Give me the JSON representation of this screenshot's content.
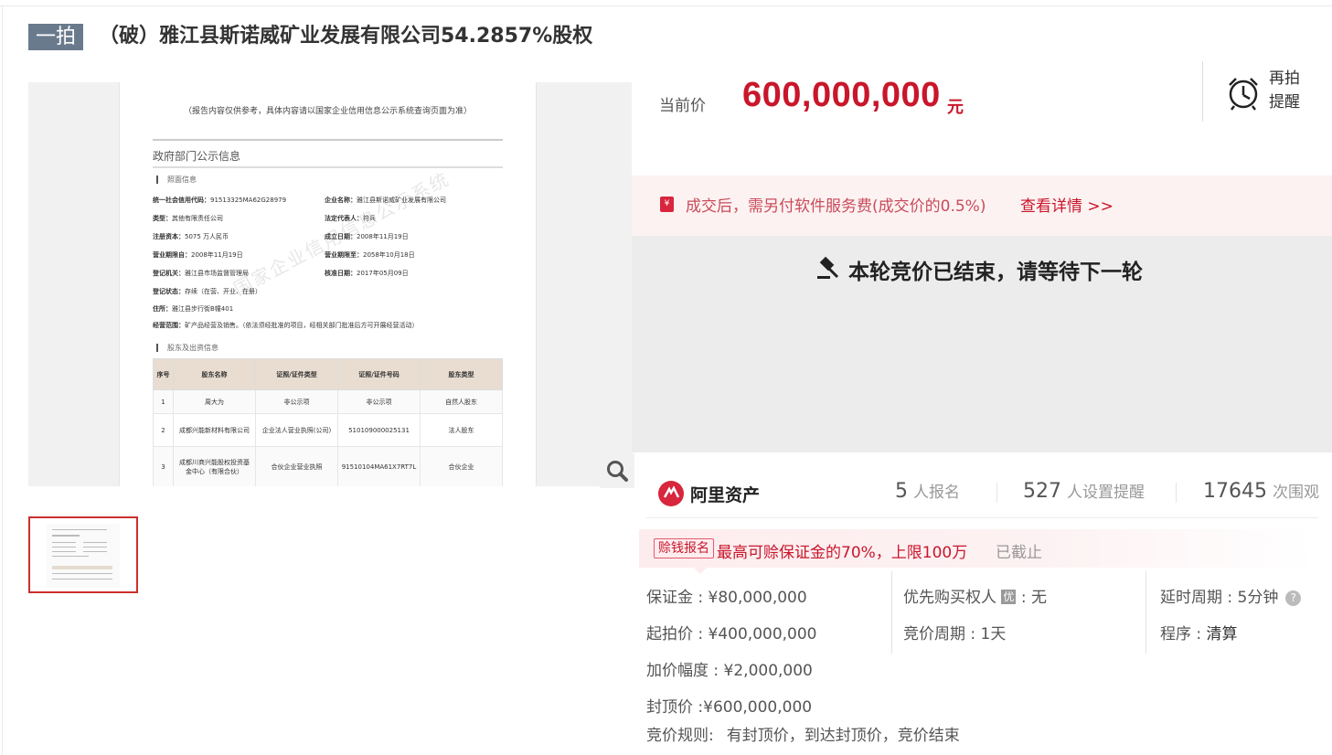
{
  "header": {
    "round_badge": "一拍",
    "title": "（破）雅江县斯诺威矿业发展有限公司54.2857%股权"
  },
  "gallery": {
    "doc_note": "（报告内容仅供参考，具体内容请以国家企业信用信息公示系统查询页面为准）",
    "section_title": "政府部门公示信息",
    "sub_license": "照面信息",
    "watermark": "国家企业信用信息公示系统",
    "fields": [
      {
        "k": "统一社会信用代码：",
        "v": "91513325MA62G28979"
      },
      {
        "k": "企业名称：",
        "v": "雅江县斯诺威矿业发展有限公司"
      },
      {
        "k": "类型：",
        "v": "其他有限责任公司"
      },
      {
        "k": "法定代表人：",
        "v": "符兵"
      },
      {
        "k": "注册资本：",
        "v": "5075 万人民币"
      },
      {
        "k": "成立日期：",
        "v": "2008年11月19日"
      },
      {
        "k": "营业期限自：",
        "v": "2008年11月19日"
      },
      {
        "k": "营业期限至：",
        "v": "2058年10月18日"
      },
      {
        "k": "登记机关：",
        "v": "雅江县市场监督管理局"
      },
      {
        "k": "核准日期：",
        "v": "2017年05月09日"
      },
      {
        "k": "登记状态：",
        "v": "存续（在营、开业、在册）"
      },
      {
        "k": "住所：",
        "v": "雅江县步行街B幢401"
      },
      {
        "k": "经营范围：",
        "v": "矿产品经营及销售。（依法须经批准的项目，经相关部门批准后方可开展经营活动）"
      }
    ],
    "sub_shareholders": "股东及出资信息",
    "table_headers": [
      "序号",
      "股东名称",
      "证照/证件类型",
      "证照/证件号码",
      "股东类型"
    ],
    "table_rows": [
      [
        "1",
        "周大为",
        "非公示项",
        "非公示项",
        "自然人股东"
      ],
      [
        "2",
        "成都兴能新材料有限公司",
        "企业法人营业执照(公司)",
        "510109000025131",
        "法人股东"
      ],
      [
        "3",
        "成都川商兴能股权投资基金中心（有限合伙）",
        "合伙企业营业执照",
        "91510104MA61X7RT7L",
        "合伙企业"
      ]
    ]
  },
  "price": {
    "label": "当前价",
    "value": "600,000,000",
    "unit": "元",
    "remind_line1": "再拍",
    "remind_line2": "提醒"
  },
  "fee": {
    "icon_char": "¥",
    "text": "成交后，需另付软件服务费(成交价的0.5%)",
    "link": "查看详情 >>"
  },
  "status": {
    "ended_text": "本轮竞价已结束，请等待下一轮"
  },
  "stats": {
    "brand": "阿里资产",
    "signups_num": "5",
    "signups_label": "人报名",
    "reminders_num": "527",
    "reminders_label": "人设置提醒",
    "views_num": "17645",
    "views_label": "次围观"
  },
  "bonus": {
    "tag": "赊钱报名",
    "text": "最高可赊保证金的70%，上限100万",
    "status": "已截止"
  },
  "details": {
    "deposit": "保证金 : ¥80,000,000",
    "start_price": "起拍价 : ¥400,000,000",
    "increment": "加价幅度 : ¥2,000,000",
    "cap_price": "封顶价 :¥600,000,000",
    "priority_label": "优先购买权人",
    "priority_badge": "优",
    "priority_value": ": 无",
    "cycle": "竞价周期 : 1天",
    "delay": "延时周期 : 5分钟",
    "help": "?",
    "procedure_label": "程序 : ",
    "procedure_value": "清算",
    "rule_label": "竞价规则:",
    "rule_value": "有封顶价，到达封顶价，竞价结束"
  },
  "colors": {
    "accent": "#c9162b",
    "badge": "#6a7a8d",
    "fee_bg": "#fdf2f2",
    "ended_bg": "#ececec"
  }
}
